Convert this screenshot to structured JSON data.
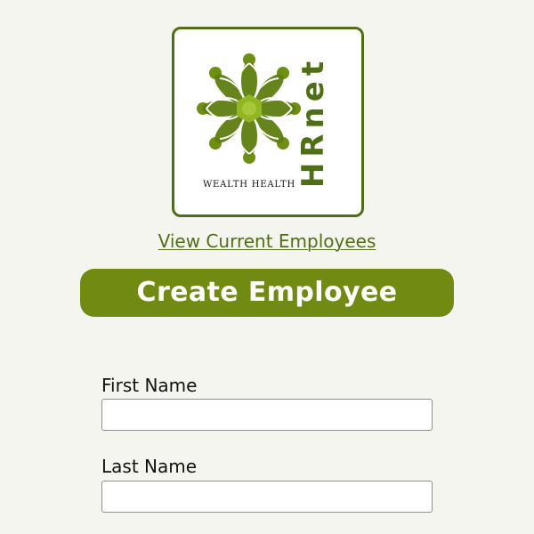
{
  "brand": {
    "vertical_text": "HRnet",
    "caption": "WEALTH HEALTH",
    "logo_icon": "leaf-medallion-icon",
    "primary_color": "#4f6f16",
    "accent_color": "#708a12",
    "light_accent_color": "#90b623"
  },
  "navigation": {
    "link_label": "View Current Employees"
  },
  "page": {
    "title": "Create Employee"
  },
  "form": {
    "first_name": {
      "label": "First Name",
      "value": "",
      "placeholder": ""
    },
    "last_name": {
      "label": "Last Name",
      "value": "",
      "placeholder": ""
    }
  },
  "colors": {
    "background": "#f5f5f0",
    "text": "#111111",
    "input_border": "#8f8f8f"
  }
}
